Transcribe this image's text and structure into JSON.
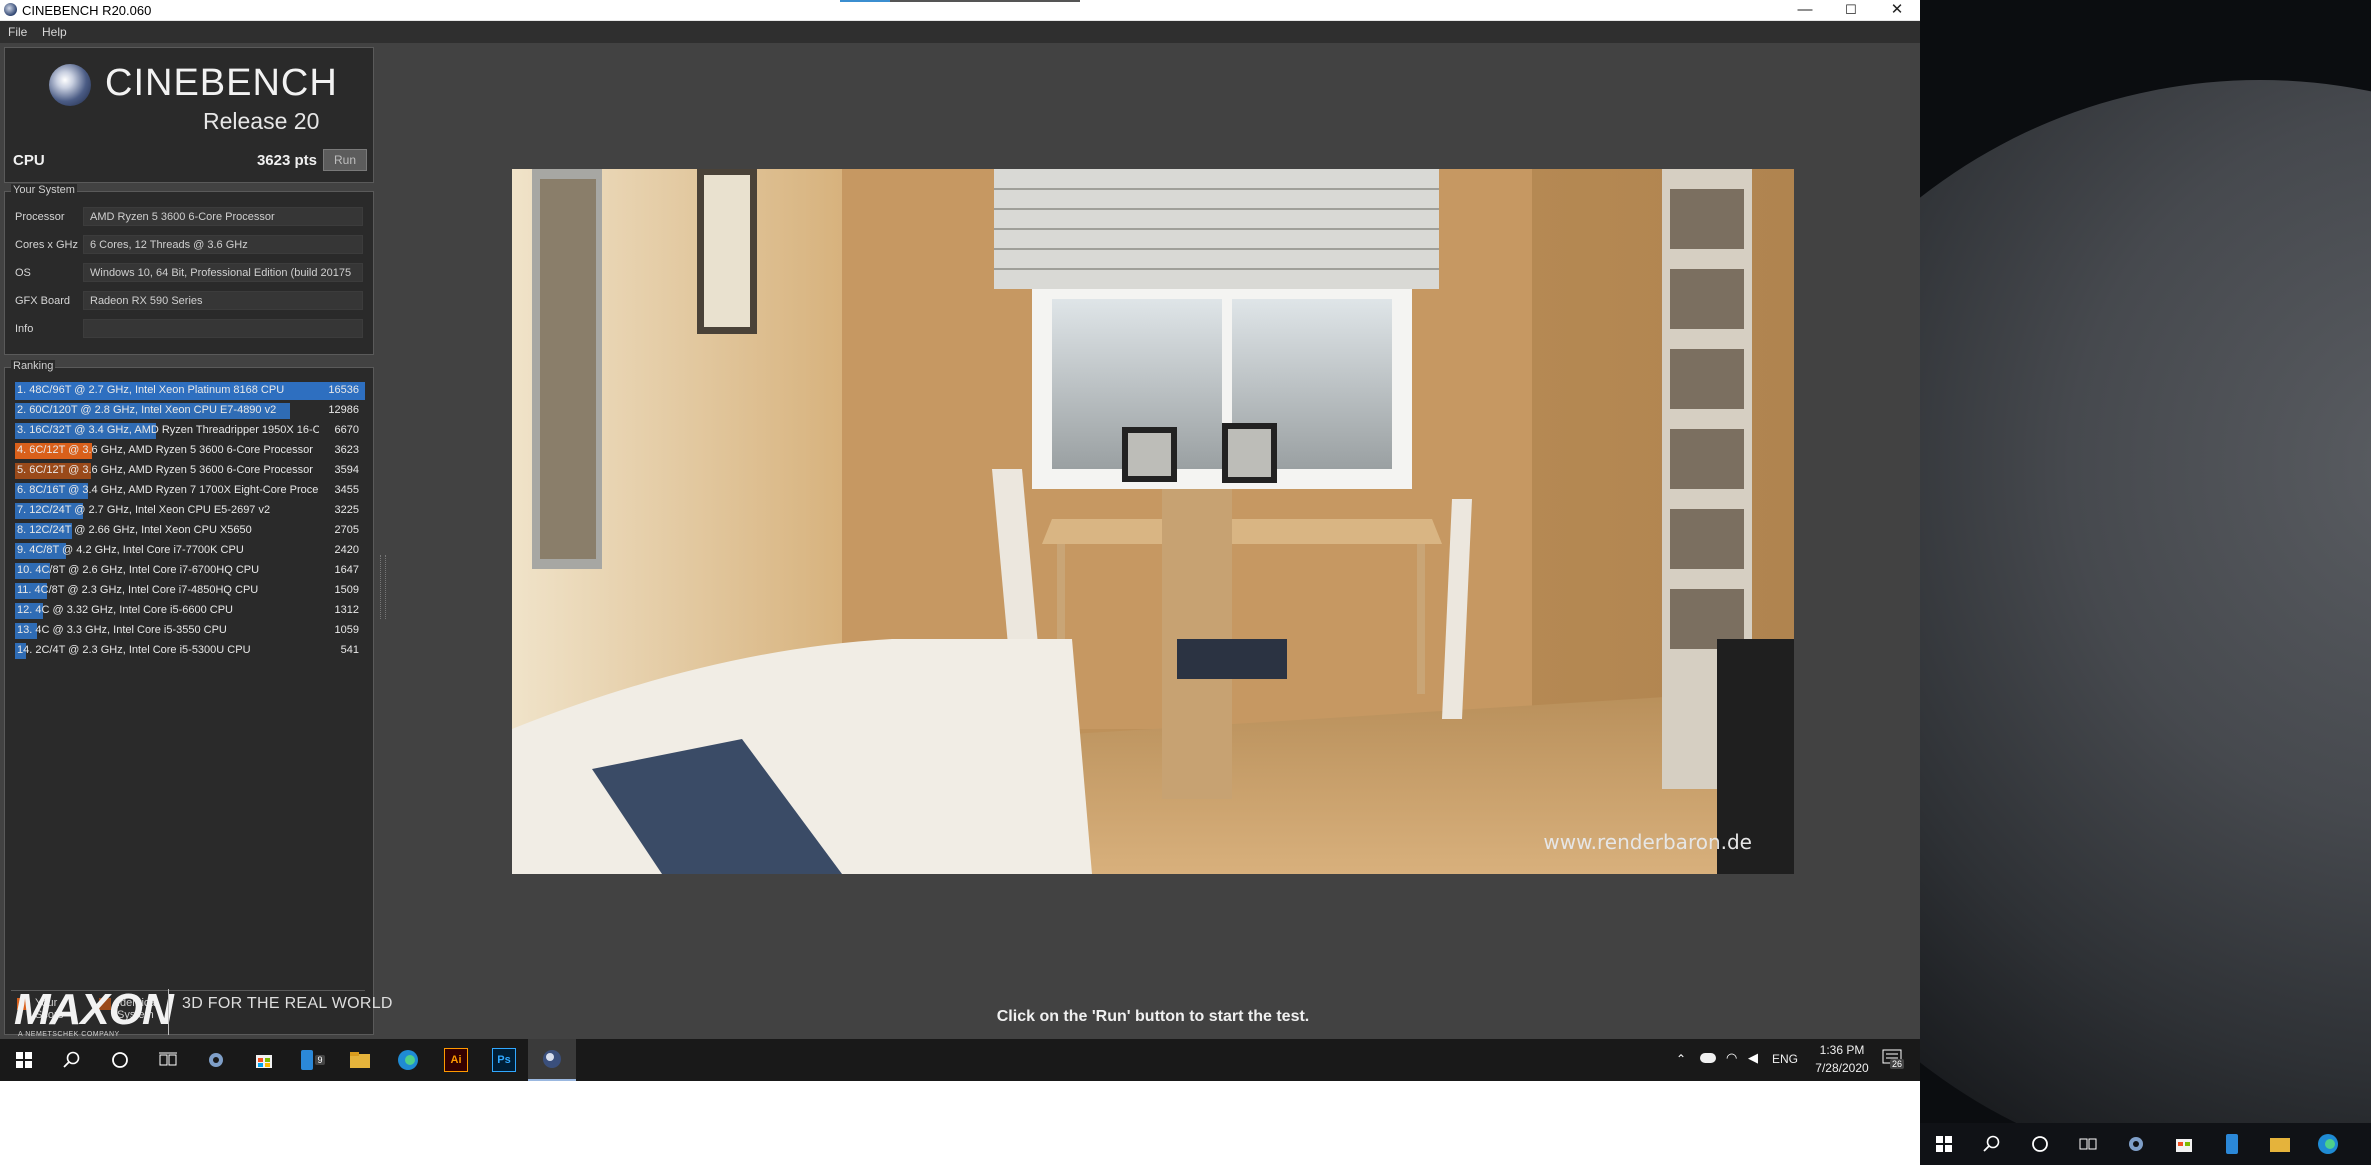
{
  "window": {
    "title": "CINEBENCH R20.060",
    "minimize_glyph": "—",
    "maximize_glyph": "☐",
    "close_glyph": "✕"
  },
  "menu": {
    "items": [
      "File",
      "Help"
    ]
  },
  "logo": {
    "name": "CINEBENCH",
    "release": "Release 20"
  },
  "cpu": {
    "label": "CPU",
    "score": "3623 pts",
    "run_label": "Run"
  },
  "system": {
    "header": "Your System",
    "rows": [
      {
        "label": "Processor",
        "value": "AMD Ryzen 5 3600 6-Core Processor"
      },
      {
        "label": "Cores x GHz",
        "value": "6 Cores, 12 Threads @ 3.6 GHz"
      },
      {
        "label": "OS",
        "value": "Windows 10, 64 Bit, Professional Edition (build 20175"
      },
      {
        "label": "GFX Board",
        "value": "Radeon RX 590 Series"
      },
      {
        "label": "Info",
        "value": ""
      }
    ]
  },
  "ranking": {
    "header": "Ranking",
    "max_score": 16536,
    "rows": [
      {
        "text": "1. 48C/96T @ 2.7 GHz, Intel Xeon Platinum 8168 CPU",
        "score": "16536",
        "value": 16536,
        "kind": "other",
        "highlight": true
      },
      {
        "text": "2. 60C/120T @ 2.8 GHz, Intel Xeon CPU E7-4890 v2",
        "score": "12986",
        "value": 12986,
        "kind": "other",
        "highlight": false
      },
      {
        "text": "3. 16C/32T @ 3.4 GHz, AMD Ryzen Threadripper 1950X 16-C",
        "score": "6670",
        "value": 6670,
        "kind": "other",
        "highlight": false
      },
      {
        "text": "4. 6C/12T @ 3.6 GHz, AMD Ryzen 5 3600 6-Core Processor",
        "score": "3623",
        "value": 3623,
        "kind": "yours",
        "highlight": false
      },
      {
        "text": "5. 6C/12T @ 3.6 GHz, AMD Ryzen 5 3600 6-Core Processor",
        "score": "3594",
        "value": 3594,
        "kind": "identical",
        "highlight": false
      },
      {
        "text": "6. 8C/16T @ 3.4 GHz, AMD Ryzen 7 1700X Eight-Core Proce:",
        "score": "3455",
        "value": 3455,
        "kind": "other",
        "highlight": false
      },
      {
        "text": "7. 12C/24T @ 2.7 GHz, Intel Xeon CPU E5-2697 v2",
        "score": "3225",
        "value": 3225,
        "kind": "other",
        "highlight": false
      },
      {
        "text": "8. 12C/24T @ 2.66 GHz, Intel Xeon CPU X5650",
        "score": "2705",
        "value": 2705,
        "kind": "other",
        "highlight": false
      },
      {
        "text": "9. 4C/8T @ 4.2 GHz, Intel Core i7-7700K CPU",
        "score": "2420",
        "value": 2420,
        "kind": "other",
        "highlight": false
      },
      {
        "text": "10. 4C/8T @ 2.6 GHz, Intel Core i7-6700HQ CPU",
        "score": "1647",
        "value": 1647,
        "kind": "other",
        "highlight": false
      },
      {
        "text": "11. 4C/8T @ 2.3 GHz, Intel Core i7-4850HQ CPU",
        "score": "1509",
        "value": 1509,
        "kind": "other",
        "highlight": false
      },
      {
        "text": "12. 4C @ 3.32 GHz, Intel Core i5-6600 CPU",
        "score": "1312",
        "value": 1312,
        "kind": "other",
        "highlight": false
      },
      {
        "text": "13. 4C @ 3.3 GHz, Intel Core i5-3550 CPU",
        "score": "1059",
        "value": 1059,
        "kind": "other",
        "highlight": false
      },
      {
        "text": "14. 2C/4T @ 2.3 GHz, Intel Core i5-5300U CPU",
        "score": "541",
        "value": 541,
        "kind": "other",
        "highlight": false
      }
    ],
    "colors": {
      "other": "#2f6cb5",
      "yours": "#d9601b",
      "identical": "#9a4a1a"
    },
    "legend": {
      "yours": "Your Score",
      "identical": "Identical System"
    }
  },
  "footer": {
    "brand": "MAXON",
    "brand_sub": "A NEMETSCHEK COMPANY",
    "tagline": "3D FOR THE REAL WORLD"
  },
  "render": {
    "watermark": "www.renderbaron.de"
  },
  "status": {
    "message": "Click on the 'Run' button to start the test."
  },
  "taskbar": {
    "icons": [
      "windows-start-icon",
      "search-icon",
      "cortana-icon",
      "task-view-icon",
      "settings-icon",
      "store-icon",
      "phone-icon",
      "file-explorer-icon",
      "edge-icon",
      "illustrator-icon",
      "photoshop-icon",
      "cinebench-icon"
    ],
    "phone_badge": "9",
    "ai_label": "Ai",
    "ps_label": "Ps",
    "lang": "ENG",
    "time": "1:36 PM",
    "date": "7/28/2020",
    "notifications": "26"
  }
}
